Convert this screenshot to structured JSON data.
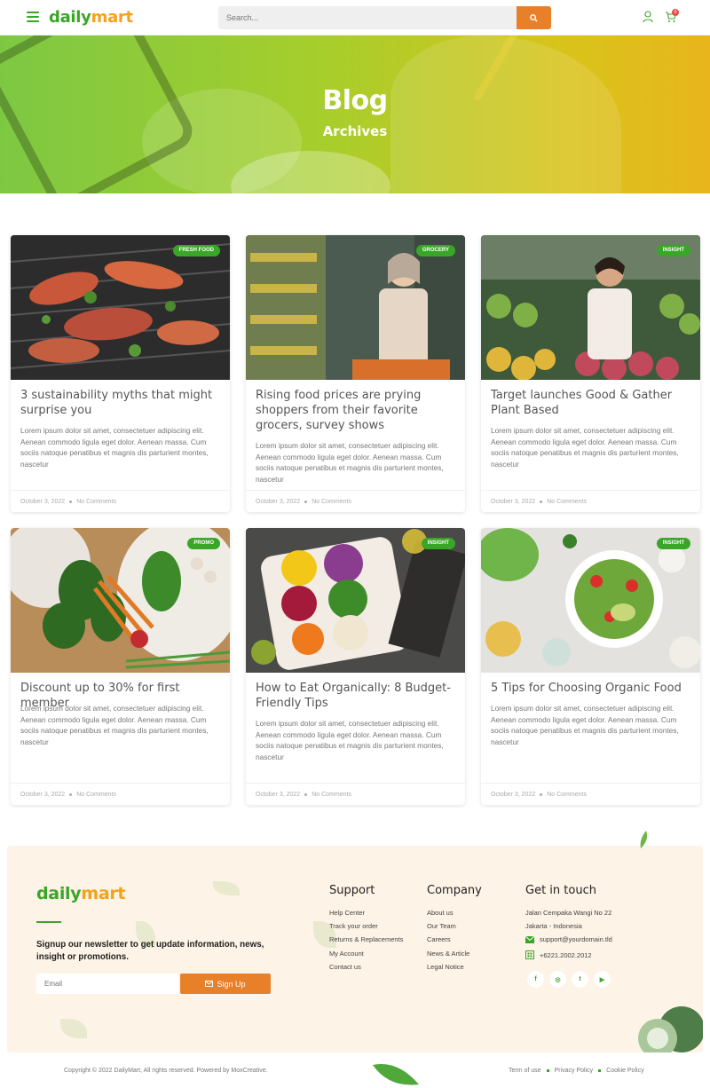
{
  "header": {
    "logo_part1": "daily",
    "logo_part2": "mart",
    "search_placeholder": "Search...",
    "cart_count": "0"
  },
  "hero": {
    "title": "Blog",
    "subtitle": "Archives"
  },
  "posts": [
    {
      "tag": "FRESH FOOD",
      "title": "3 sustainability myths that might surprise you",
      "excerpt": "Lorem ipsum dolor sit amet, consectetuer adipiscing elit. Aenean commodo ligula eget dolor. Aenean massa. Cum sociis natoque penatibus et magnis dis parturient montes, nascetur",
      "date": "October 3, 2022",
      "comments": "No Comments"
    },
    {
      "tag": "GROCERY",
      "title": "Rising food prices are prying shoppers from their favorite grocers, survey shows",
      "excerpt": "Lorem ipsum dolor sit amet, consectetuer adipiscing elit. Aenean commodo ligula eget dolor. Aenean massa. Cum sociis natoque penatibus et magnis dis parturient montes, nascetur",
      "date": "October 3, 2022",
      "comments": "No Comments"
    },
    {
      "tag": "INSIGHT",
      "title": "Target launches Good & Gather Plant Based",
      "excerpt": "Lorem ipsum dolor sit amet, consectetuer adipiscing elit. Aenean commodo ligula eget dolor. Aenean massa. Cum sociis natoque penatibus et magnis dis parturient montes, nascetur",
      "date": "October 3, 2022",
      "comments": "No Comments"
    },
    {
      "tag": "PROMO",
      "title": "Discount up to 30% for first member",
      "excerpt": "Lorem ipsum dolor sit amet, consectetuer adipiscing elit. Aenean commodo ligula eget dolor. Aenean massa. Cum sociis natoque penatibus et magnis dis parturient montes, nascetur",
      "date": "October 3, 2022",
      "comments": "No Comments"
    },
    {
      "tag": "INSIGHT",
      "title": "How to Eat Organically: 8 Budget-Friendly Tips",
      "excerpt": "Lorem ipsum dolor sit amet, consectetuer adipiscing elit. Aenean commodo ligula eget dolor. Aenean massa. Cum sociis natoque penatibus et magnis dis parturient montes, nascetur",
      "date": "October 3, 2022",
      "comments": "No Comments"
    },
    {
      "tag": "INSIGHT",
      "title": "5 Tips for Choosing Organic Food",
      "excerpt": "Lorem ipsum dolor sit amet, consectetuer adipiscing elit. Aenean commodo ligula eget dolor. Aenean massa. Cum sociis natoque penatibus et magnis dis parturient montes, nascetur",
      "date": "October 3, 2022",
      "comments": "No Comments"
    }
  ],
  "footer": {
    "logo_part1": "daily",
    "logo_part2": "mart",
    "newsletter_text": "Signup our newsletter to get update information, news, insight or promotions.",
    "email_placeholder": "Email",
    "signup_label": "Sign Up",
    "support": {
      "title": "Support",
      "links": [
        "Help Center",
        "Track your order",
        "Returns & Replacements",
        "My Account",
        "Contact us"
      ]
    },
    "company": {
      "title": "Company",
      "links": [
        "About us",
        "Our Team",
        "Careers",
        "News & Article",
        "Legal Notice"
      ]
    },
    "contact": {
      "title": "Get in touch",
      "address1": "Jalan Cempaka Wangi No 22",
      "address2": "Jakarta - Indonesia",
      "email": "support@yourdomain.tld",
      "phone": "+6221.2002.2012"
    },
    "social": [
      "f",
      "◎",
      "t",
      "▶"
    ]
  },
  "bottom": {
    "copyright": "Copyright © 2022 DailyMart, All rights reserved. Powered by MoxCreative.",
    "terms": "Term of use",
    "privacy": "Privacy Policy",
    "cookie": "Cookie Policy"
  },
  "colors": {
    "brand_green": "#3aa628",
    "brand_orange": "#e8802a",
    "footer_bg": "#fdf3e6"
  }
}
